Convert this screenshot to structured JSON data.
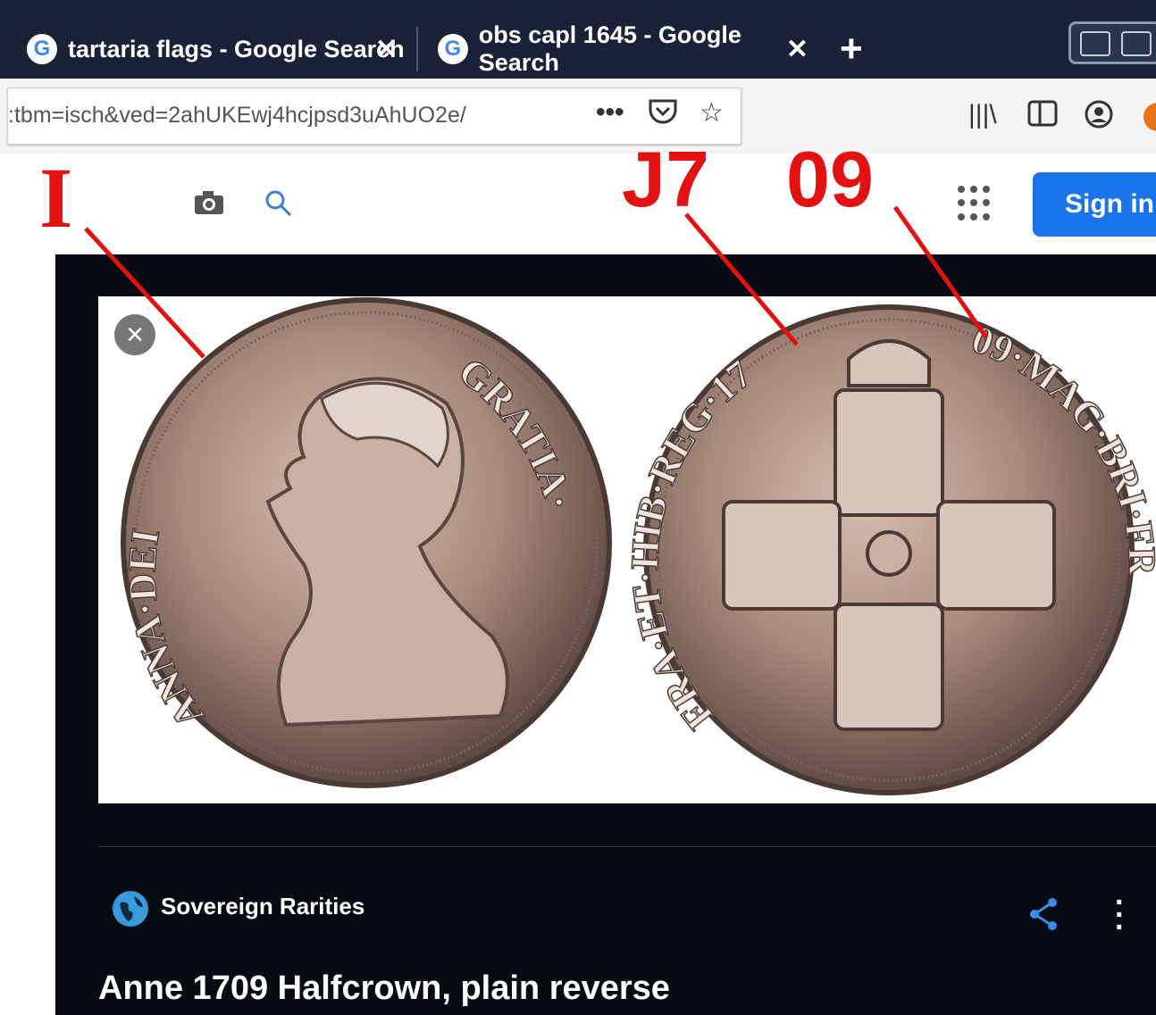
{
  "tabs": [
    {
      "label": "tartaria flags - Google Search",
      "close": "✕"
    },
    {
      "label": "obs capl 1645 - Google Search",
      "close": "✕"
    }
  ],
  "new_tab": "+",
  "url": {
    "text": ":tbm=isch&ved=2ahUKEwj4hcjpsd3uAhUO2e/"
  },
  "toolbar_icons": [
    "more-icon",
    "pocket-icon",
    "bookmark-star-icon",
    "library-icon",
    "sidebar-icon",
    "account-icon"
  ],
  "google": {
    "sign_in": "Sign in"
  },
  "annotations": {
    "a1": "I",
    "a2": "J7",
    "a3": "09"
  },
  "coin_obverse": {
    "legend_left": "ANNA·DEI",
    "legend_right": "GRATIA·"
  },
  "coin_reverse": {
    "legend_left": "FRA·ET·HIB·REG·17",
    "legend_right": "09·MAG·BRI·FR"
  },
  "result": {
    "source": "Sovereign Rarities",
    "title": "Anne 1709 Halfcrown, plain reverse"
  },
  "colors": {
    "accent": "#1a73e8",
    "annotation": "#e31111",
    "panel": "#060a12"
  }
}
